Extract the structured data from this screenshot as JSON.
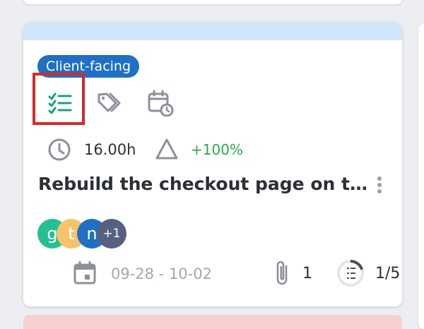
{
  "card": {
    "tag_label": "Client-facing",
    "hours": "16.00h",
    "delta": "+100%",
    "title": "Rebuild the checkout page on th…",
    "avatars": [
      {
        "initial": "g",
        "color": "#24c08f"
      },
      {
        "initial": "t",
        "color": "#f6c36c"
      },
      {
        "initial": "n",
        "color": "#1f6fc4"
      }
    ],
    "more_assignees": "+1",
    "date_range": "09-28 - 10-02",
    "attachments": "1",
    "checklist_progress": "1/5",
    "checklist_fraction": 0.2
  },
  "icons": {
    "checklist": "checklist-icon",
    "tags": "tags-icon",
    "schedule": "calendar-clock-icon",
    "estimate": "clock-icon",
    "variance": "triangle-icon",
    "due_date": "calendar-icon",
    "attachment": "paperclip-icon",
    "progress": "checklist-progress-icon",
    "more": "more-vertical-icon"
  },
  "colors": {
    "band": "#cfe6fb",
    "tag": "#1f6fc4",
    "positive": "#2ea84f",
    "icon_green": "#1aa37a",
    "icon_gray": "#8b909a",
    "highlight": "#d12b2b",
    "next_card": "#f6d1d1"
  }
}
